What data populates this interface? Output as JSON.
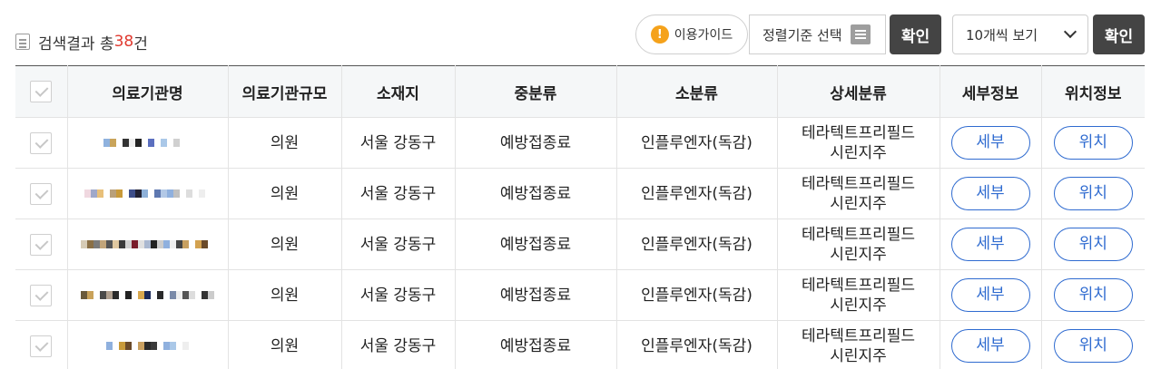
{
  "summary": {
    "prefix": "검색결과 총 ",
    "count": "38",
    "suffix": "건"
  },
  "toolbar": {
    "guide_label": "이용가이드",
    "sort_label": "정렬기준 선택",
    "confirm_label": "확인",
    "page_size_label": "10개씩 보기",
    "confirm2_label": "확인"
  },
  "table": {
    "headers": [
      "의료기관명",
      "의료기관규모",
      "소재지",
      "중분류",
      "소분류",
      "상세분류",
      "세부정보",
      "위치정보"
    ],
    "rows": [
      {
        "scale": "의원",
        "location": "서울 강동구",
        "mid": "예방접종료",
        "sub": "인플루엔자(독감)",
        "detail1": "테라텍트프리필드",
        "detail2": "시린지주",
        "detail_btn": "세부",
        "loc_btn": "위치"
      },
      {
        "scale": "의원",
        "location": "서울 강동구",
        "mid": "예방접종료",
        "sub": "인플루엔자(독감)",
        "detail1": "테라텍트프리필드",
        "detail2": "시린지주",
        "detail_btn": "세부",
        "loc_btn": "위치"
      },
      {
        "scale": "의원",
        "location": "서울 강동구",
        "mid": "예방접종료",
        "sub": "인플루엔자(독감)",
        "detail1": "테라텍트프리필드",
        "detail2": "시린지주",
        "detail_btn": "세부",
        "loc_btn": "위치"
      },
      {
        "scale": "의원",
        "location": "서울 강동구",
        "mid": "예방접종료",
        "sub": "인플루엔자(독감)",
        "detail1": "테라텍트프리필드",
        "detail2": "시린지주",
        "detail_btn": "세부",
        "loc_btn": "위치"
      },
      {
        "scale": "의원",
        "location": "서울 강동구",
        "mid": "예방접종료",
        "sub": "인플루엔자(독감)",
        "detail1": "테라텍트프리필드",
        "detail2": "시린지주",
        "detail_btn": "세부",
        "loc_btn": "위치"
      }
    ]
  },
  "colors": {
    "accent": "#2f6bd0",
    "count": "#e0392f",
    "dark_button": "#444444",
    "info_icon": "#f5a21b"
  },
  "icons": [
    "document-icon",
    "info-icon",
    "list-icon",
    "chevron-down-icon",
    "checkbox"
  ]
}
